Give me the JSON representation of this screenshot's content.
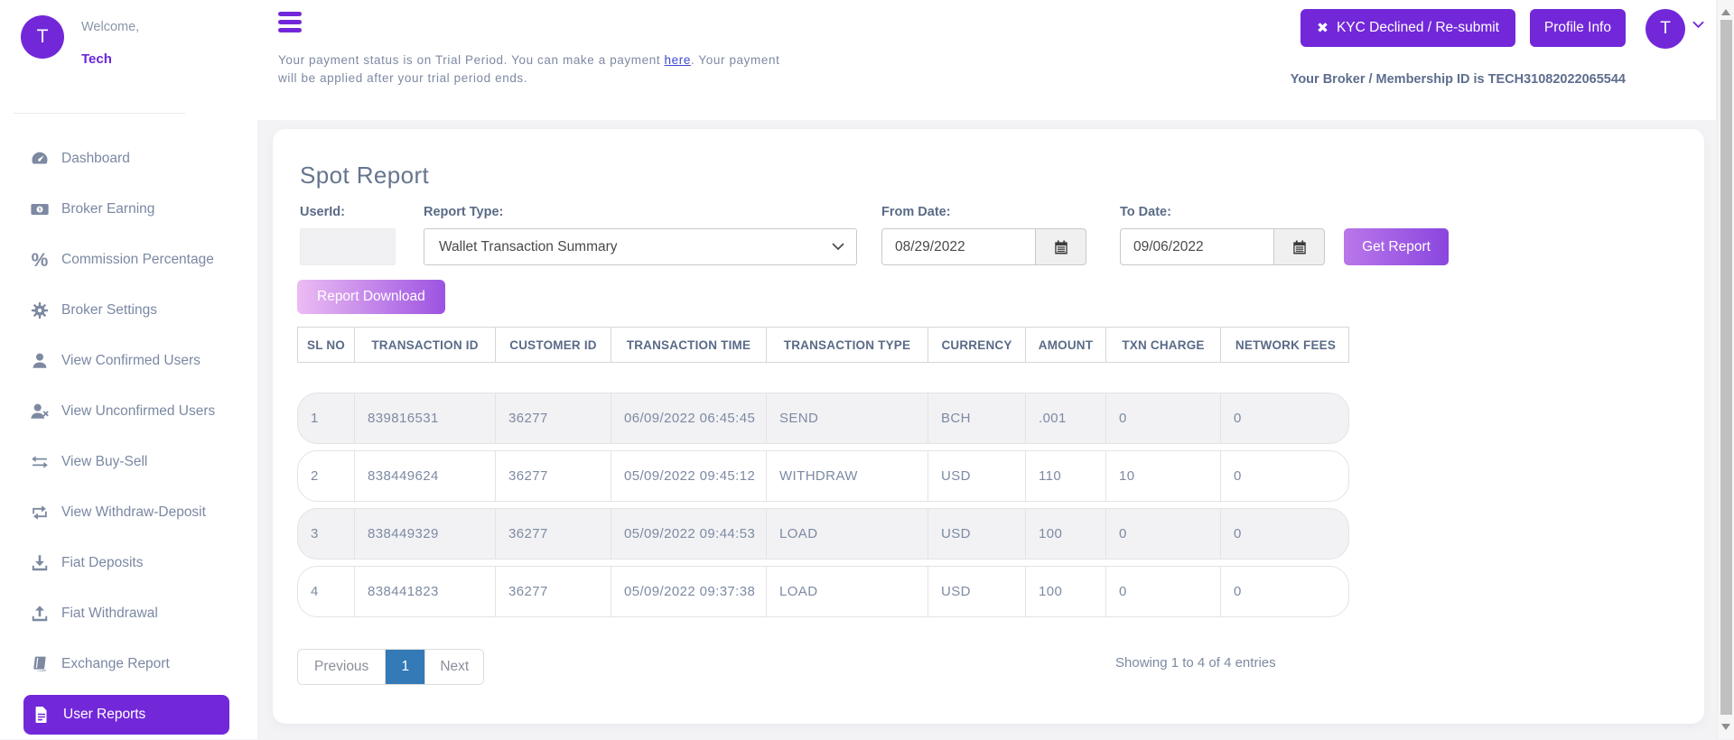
{
  "app": {
    "accent_color": "#7228d9",
    "pagination_active_color": "#337ab7",
    "background_color": "#f3f3f5"
  },
  "sidebar": {
    "avatar_initial": "T",
    "welcome_label": "Welcome,",
    "username": "Tech",
    "items": [
      {
        "label": "Dashboard",
        "icon": "dashboard-gauge",
        "active": false
      },
      {
        "label": "Broker Earning",
        "icon": "money-bill",
        "active": false
      },
      {
        "label": "Commission Percentage",
        "icon": "percent",
        "icon_glyph": "%",
        "active": false
      },
      {
        "label": "Broker Settings",
        "icon": "gear",
        "active": false
      },
      {
        "label": "View Confirmed Users",
        "icon": "user",
        "active": false
      },
      {
        "label": "View Unconfirmed Users",
        "icon": "user-x",
        "active": false
      },
      {
        "label": "View Buy-Sell",
        "icon": "exchange-arrows",
        "active": false
      },
      {
        "label": "View Withdraw-Deposit",
        "icon": "repeat-arrows",
        "active": false
      },
      {
        "label": "Fiat Deposits",
        "icon": "download-tray",
        "active": false
      },
      {
        "label": "Fiat Withdrawal",
        "icon": "upload-tray",
        "active": false
      },
      {
        "label": "Exchange Report",
        "icon": "book",
        "active": false
      },
      {
        "label": "User Reports",
        "icon": "document",
        "active": true
      }
    ]
  },
  "header": {
    "kyc_button_icon": "✖",
    "kyc_button_label": "KYC Declined / Re-submit",
    "profile_button_label": "Profile Info",
    "avatar_initial": "T",
    "broker_id_text": "Your Broker / Membership ID is TECH31082022065544",
    "payment_notice": {
      "line1_before_link": "Your payment status is on Trial Period. You can make a payment ",
      "link_text": "here",
      "line1_after_link": ". Your payment",
      "line2": "will be applied after your trial period ends."
    }
  },
  "report": {
    "title": "Spot Report",
    "filters": {
      "userid_label": "UserId:",
      "userid_value": "",
      "report_type_label": "Report Type:",
      "report_type_value": "Wallet Transaction Summary",
      "from_date_label": "From Date:",
      "from_date_value": "08/29/2022",
      "to_date_label": "To Date:",
      "to_date_value": "09/06/2022",
      "get_report_label": "Get Report",
      "download_label": "Report Download"
    },
    "table": {
      "headers": [
        "SL NO",
        "TRANSACTION ID",
        "CUSTOMER ID",
        "TRANSACTION TIME",
        "TRANSACTION TYPE",
        "CURRENCY",
        "AMOUNT",
        "TXN CHARGE",
        "NETWORK FEES"
      ],
      "rows": [
        [
          "1",
          "839816531",
          "36277",
          "06/09/2022 06:45:45",
          "SEND",
          "BCH",
          ".001",
          "0",
          "0"
        ],
        [
          "2",
          "838449624",
          "36277",
          "05/09/2022 09:45:12",
          "WITHDRAW",
          "USD",
          "110",
          "10",
          "0"
        ],
        [
          "3",
          "838449329",
          "36277",
          "05/09/2022 09:44:53",
          "LOAD",
          "USD",
          "100",
          "0",
          "0"
        ],
        [
          "4",
          "838441823",
          "36277",
          "05/09/2022 09:37:38",
          "LOAD",
          "USD",
          "100",
          "0",
          "0"
        ]
      ]
    },
    "pagination": {
      "previous_label": "Previous",
      "page_label": "1",
      "next_label": "Next",
      "summary": "Showing 1 to 4 of 4 entries"
    }
  }
}
